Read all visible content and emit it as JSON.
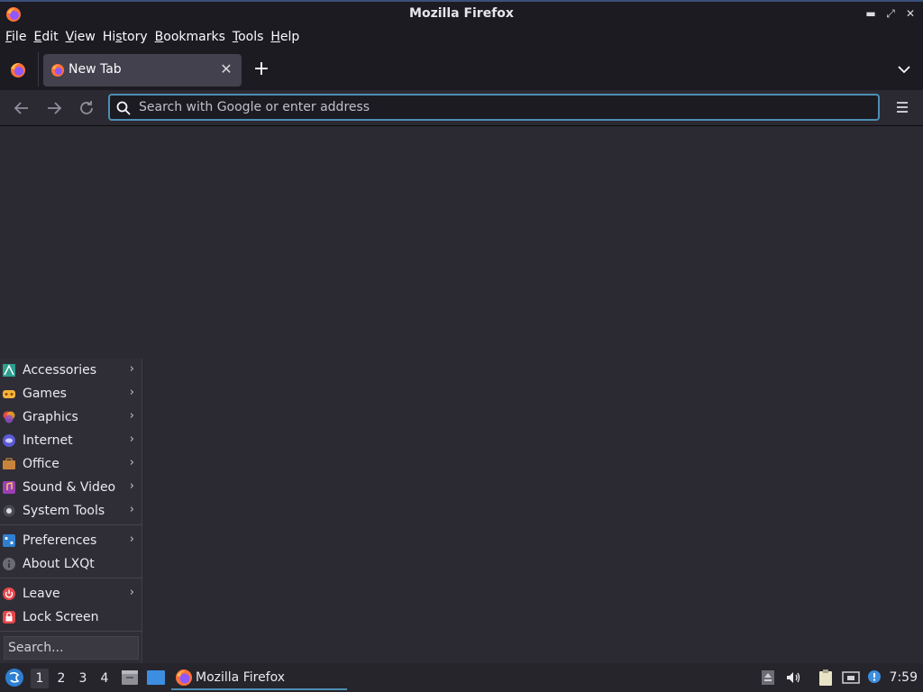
{
  "window": {
    "title": "Mozilla Firefox"
  },
  "menubar": {
    "items": [
      {
        "pre": "",
        "u": "F",
        "post": "ile"
      },
      {
        "pre": "",
        "u": "E",
        "post": "dit"
      },
      {
        "pre": "",
        "u": "V",
        "post": "iew"
      },
      {
        "pre": "Hi",
        "u": "s",
        "post": "tory"
      },
      {
        "pre": "",
        "u": "B",
        "post": "ookmarks"
      },
      {
        "pre": "",
        "u": "T",
        "post": "ools"
      },
      {
        "pre": "",
        "u": "H",
        "post": "elp"
      }
    ]
  },
  "tabs": [
    {
      "label": "New Tab",
      "active": true
    }
  ],
  "urlbar": {
    "placeholder": "Search with Google or enter address",
    "value": ""
  },
  "start_menu": {
    "items": [
      {
        "label": "Accessories",
        "icon": "accessories-icon",
        "submenu": true
      },
      {
        "label": "Games",
        "icon": "games-icon",
        "submenu": true
      },
      {
        "label": "Graphics",
        "icon": "graphics-icon",
        "submenu": true
      },
      {
        "label": "Internet",
        "icon": "internet-icon",
        "submenu": true
      },
      {
        "label": "Office",
        "icon": "office-icon",
        "submenu": true
      },
      {
        "label": "Sound & Video",
        "icon": "sound-video-icon",
        "submenu": true
      },
      {
        "label": "System Tools",
        "icon": "system-tools-icon",
        "submenu": true
      },
      {
        "label": "Preferences",
        "icon": "preferences-icon",
        "submenu": true
      },
      {
        "label": "About LXQt",
        "icon": "info-icon",
        "submenu": false
      },
      {
        "label": "Leave",
        "icon": "power-icon",
        "submenu": true
      },
      {
        "label": "Lock Screen",
        "icon": "lock-icon",
        "submenu": false
      }
    ],
    "search_placeholder": "Search..."
  },
  "taskbar": {
    "desktops": [
      "1",
      "2",
      "3",
      "4"
    ],
    "active_desktop": "1",
    "tasks": [
      {
        "label": "Mozilla Firefox"
      }
    ],
    "clock": "7:59"
  },
  "colors": {
    "accent": "#4d8eb3",
    "window_bg": "#2b2a33",
    "chrome_bg": "#1c1b22",
    "menu_bg": "#2f2e36"
  }
}
